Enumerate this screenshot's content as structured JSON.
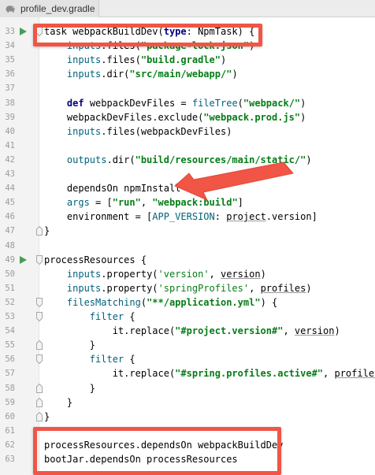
{
  "tab": {
    "label": "profile_dev.gradle",
    "icon": "gradle-elephant-icon"
  },
  "colors": {
    "highlight": "#f05545",
    "function": "#00627a",
    "keyword": "#000080",
    "string": "#067d17",
    "gutter": "#f3f3f3"
  },
  "lines": [
    {
      "n": "33",
      "run": true,
      "fold": "open",
      "segs": [
        [
          "task webpackBuildDev(",
          ""
        ],
        [
          "type",
          "kw"
        ],
        [
          ": NpmTask) {",
          ""
        ]
      ]
    },
    {
      "n": "34",
      "segs": [
        [
          "    ",
          ""
        ],
        [
          "inputs",
          "fn"
        ],
        [
          ".files(",
          ""
        ],
        [
          "\"package-lock.json\"",
          "str"
        ],
        [
          ")",
          ""
        ]
      ]
    },
    {
      "n": "35",
      "segs": [
        [
          "    ",
          ""
        ],
        [
          "inputs",
          "fn"
        ],
        [
          ".files(",
          ""
        ],
        [
          "\"build.gradle\"",
          "str"
        ],
        [
          ")",
          ""
        ]
      ]
    },
    {
      "n": "36",
      "segs": [
        [
          "    ",
          ""
        ],
        [
          "inputs",
          "fn"
        ],
        [
          ".dir(",
          ""
        ],
        [
          "\"src/main/webapp/\"",
          "str"
        ],
        [
          ")",
          ""
        ]
      ]
    },
    {
      "n": "37",
      "segs": []
    },
    {
      "n": "38",
      "segs": [
        [
          "    ",
          ""
        ],
        [
          "def",
          "kw"
        ],
        [
          " webpackDevFiles = ",
          ""
        ],
        [
          "fileTree",
          "fn"
        ],
        [
          "(",
          ""
        ],
        [
          "\"webpack/\"",
          "str"
        ],
        [
          ")",
          ""
        ]
      ]
    },
    {
      "n": "39",
      "segs": [
        [
          "    webpackDevFiles.exclude(",
          ""
        ],
        [
          "\"webpack.prod.js\"",
          "str"
        ],
        [
          ")",
          ""
        ]
      ]
    },
    {
      "n": "40",
      "segs": [
        [
          "    ",
          ""
        ],
        [
          "inputs",
          "fn"
        ],
        [
          ".files(webpackDevFiles)",
          ""
        ]
      ]
    },
    {
      "n": "41",
      "segs": []
    },
    {
      "n": "42",
      "segs": [
        [
          "    ",
          ""
        ],
        [
          "outputs",
          "fn"
        ],
        [
          ".dir(",
          ""
        ],
        [
          "\"build/resources/main/static/\"",
          "str"
        ],
        [
          ")",
          ""
        ]
      ]
    },
    {
      "n": "43",
      "segs": []
    },
    {
      "n": "44",
      "segs": [
        [
          "    dependsOn npmInstall",
          ""
        ]
      ]
    },
    {
      "n": "45",
      "segs": [
        [
          "    ",
          ""
        ],
        [
          "args",
          "fn"
        ],
        [
          " = [",
          ""
        ],
        [
          "\"run\"",
          "str"
        ],
        [
          ", ",
          ""
        ],
        [
          "\"webpack:build\"",
          "str"
        ],
        [
          "]",
          ""
        ]
      ]
    },
    {
      "n": "46",
      "segs": [
        [
          "    environment = [",
          ""
        ],
        [
          "APP_VERSION",
          "fn"
        ],
        [
          ": ",
          ""
        ],
        [
          "project",
          "ul"
        ],
        [
          ".version]",
          ""
        ]
      ]
    },
    {
      "n": "47",
      "fold": "close",
      "segs": [
        [
          "}",
          ""
        ]
      ]
    },
    {
      "n": "48",
      "segs": []
    },
    {
      "n": "49",
      "run": true,
      "fold": "open",
      "segs": [
        [
          "processResources {",
          ""
        ]
      ]
    },
    {
      "n": "50",
      "segs": [
        [
          "    ",
          ""
        ],
        [
          "inputs",
          "fn"
        ],
        [
          ".property(",
          ""
        ],
        [
          "'version'",
          "sq"
        ],
        [
          ", ",
          ""
        ],
        [
          "version",
          "ul"
        ],
        [
          ")",
          ""
        ]
      ]
    },
    {
      "n": "51",
      "segs": [
        [
          "    ",
          ""
        ],
        [
          "inputs",
          "fn"
        ],
        [
          ".property(",
          ""
        ],
        [
          "'springProfiles'",
          "sq"
        ],
        [
          ", ",
          ""
        ],
        [
          "profiles",
          "ul"
        ],
        [
          ")",
          ""
        ]
      ]
    },
    {
      "n": "52",
      "fold": "open",
      "segs": [
        [
          "    ",
          ""
        ],
        [
          "filesMatching",
          "fn"
        ],
        [
          "(",
          ""
        ],
        [
          "\"**/application.yml\"",
          "str"
        ],
        [
          ") {",
          ""
        ]
      ]
    },
    {
      "n": "53",
      "fold": "open",
      "segs": [
        [
          "        ",
          ""
        ],
        [
          "filter",
          "fn"
        ],
        [
          " {",
          ""
        ]
      ]
    },
    {
      "n": "54",
      "segs": [
        [
          "            it.replace(",
          ""
        ],
        [
          "\"#project.version#\"",
          "str"
        ],
        [
          ", ",
          ""
        ],
        [
          "version",
          "ul"
        ],
        [
          ")",
          ""
        ]
      ]
    },
    {
      "n": "55",
      "fold": "close",
      "segs": [
        [
          "        }",
          ""
        ]
      ]
    },
    {
      "n": "56",
      "fold": "open",
      "segs": [
        [
          "        ",
          ""
        ],
        [
          "filter",
          "fn"
        ],
        [
          " {",
          ""
        ]
      ]
    },
    {
      "n": "57",
      "segs": [
        [
          "            it.replace(",
          ""
        ],
        [
          "\"#spring.profiles.active#\"",
          "str"
        ],
        [
          ", ",
          ""
        ],
        [
          "profiles",
          "ul"
        ],
        [
          ")",
          ""
        ]
      ]
    },
    {
      "n": "58",
      "fold": "close",
      "segs": [
        [
          "        }",
          ""
        ]
      ]
    },
    {
      "n": "59",
      "fold": "close",
      "segs": [
        [
          "    }",
          ""
        ]
      ]
    },
    {
      "n": "60",
      "fold": "close",
      "segs": [
        [
          "}",
          ""
        ]
      ]
    },
    {
      "n": "61",
      "segs": []
    },
    {
      "n": "62",
      "segs": [
        [
          "processResources.dependsOn webpackBuildDev",
          ""
        ]
      ]
    },
    {
      "n": "63",
      "segs": [
        [
          "bootJar.dependsOn processResources",
          ""
        ]
      ]
    }
  ]
}
